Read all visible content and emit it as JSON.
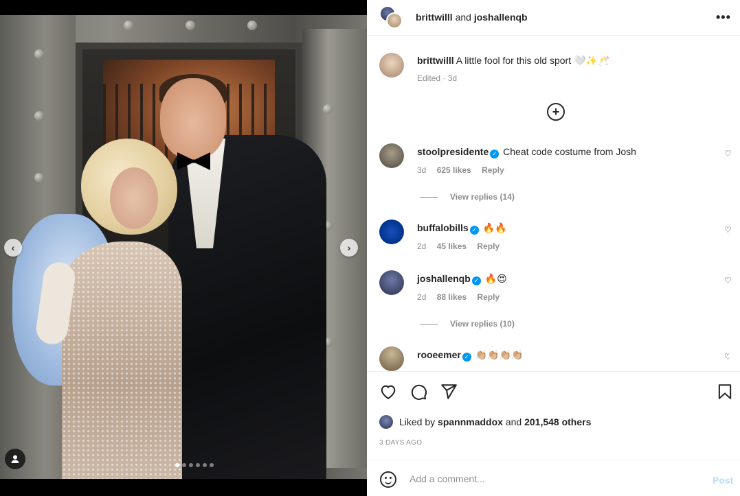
{
  "header": {
    "user1": "brittwilll",
    "conjunction": "and",
    "user2": "joshallenqb",
    "more_icon": "more-horizontal-icon"
  },
  "caption": {
    "username": "brittwilll",
    "text": "A little fool for this old sport 🤍✨🥂",
    "meta": "Edited · 3d"
  },
  "comments": [
    {
      "username": "stoolpresidente",
      "verified": true,
      "text": "Cheat code costume from Josh",
      "time": "3d",
      "likes": "625 likes",
      "reply": "Reply",
      "view_replies": "View replies (14)",
      "avatar_color": "#6f6a60"
    },
    {
      "username": "buffalobills",
      "verified": true,
      "text": "🔥🔥",
      "time": "2d",
      "likes": "45 likes",
      "reply": "Reply",
      "avatar_color": "#00338d"
    },
    {
      "username": "joshallenqb",
      "verified": true,
      "text": "🔥😍",
      "time": "2d",
      "likes": "88 likes",
      "reply": "Reply",
      "view_replies": "View replies (10)",
      "avatar_color": "#3a4168"
    },
    {
      "username": "rooeemer",
      "verified": true,
      "text": "👏🏼👏🏼👏🏼👏🏼",
      "avatar_color": "#9a8468"
    }
  ],
  "actions": {
    "liked_by_prefix": "Liked by",
    "liked_by_user": "spannmaddox",
    "liked_by_suffix": "and",
    "liked_by_count": "201,548 others",
    "timestamp": "3 DAYS AGO"
  },
  "comment_box": {
    "placeholder": "Add a comment...",
    "post_label": "Post"
  },
  "carousel": {
    "total": 6,
    "active_index": 0
  },
  "colors": {
    "verified": "#0095f6",
    "post_disabled": "#b2dffc",
    "muted_text": "#8e8e8e"
  }
}
